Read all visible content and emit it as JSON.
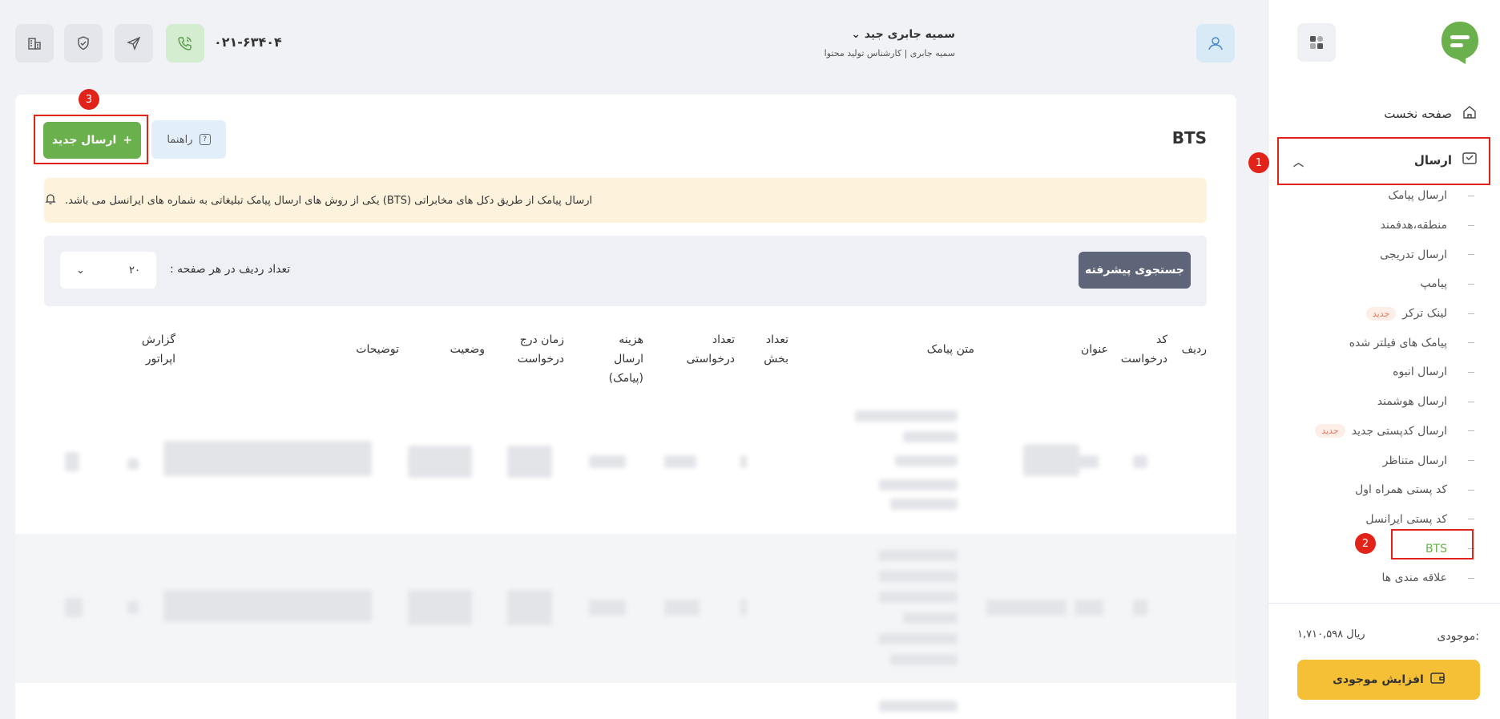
{
  "header": {
    "phone": "۰۲۱-۶۳۴۰۴",
    "user_name": "سمیه جابری جید",
    "user_role": "سمیه جابری | کارشناس تولید محتوا"
  },
  "sidebar": {
    "home": "صفحه نخست",
    "send": "ارسال",
    "items": [
      {
        "label": "ارسال پیامک"
      },
      {
        "label": "منطقه،هدفمند"
      },
      {
        "label": "ارسال تدریجی"
      },
      {
        "label": "پیامپ"
      },
      {
        "label": "لینک ترکر",
        "badge": "جدید"
      },
      {
        "label": "پیامک های فیلتر شده"
      },
      {
        "label": "ارسال انبوه"
      },
      {
        "label": "ارسال هوشمند"
      },
      {
        "label": "ارسال کدپستی جدید",
        "badge": "جدید"
      },
      {
        "label": "ارسال متناظر"
      },
      {
        "label": "کد پستی همراه اول"
      },
      {
        "label": "کد پستی ایرانسل"
      },
      {
        "label": "BTS"
      },
      {
        "label": "علاقه مندی ها"
      }
    ],
    "balance_label": "موجودی:",
    "balance_value": "۱,۷۱۰,۵۹۸ ریال",
    "increase_button": "افزایش موجودی"
  },
  "page": {
    "title": "BTS",
    "new_button": "ارسال جدید",
    "guide_button": "راهنما",
    "alert": "ارسال پیامک از طریق دکل های مخابراتی (BTS) یکی از روش های ارسال پیامک تبلیغاتی به شماره های ایرانسل می باشد.",
    "advanced_search": "جستجوی پیشرفته",
    "rows_label": "تعداد ردیف در هر صفحه :",
    "rows_value": "۲۰"
  },
  "table": {
    "headers": [
      "ردیف",
      "کد درخواست",
      "عنوان",
      "متن پیامک",
      "تعداد بخش",
      "تعداد درخواستی",
      "هزینه ارسال (پیامک)",
      "زمان درج درخواست",
      "وضعیت",
      "توضیحات",
      "گزارش اپراتور"
    ]
  },
  "annotations": [
    "1",
    "2",
    "3"
  ],
  "colors": {
    "accent_green": "#6ab04c",
    "highlight_red": "#e2231a",
    "balance_yellow": "#f5c035"
  }
}
